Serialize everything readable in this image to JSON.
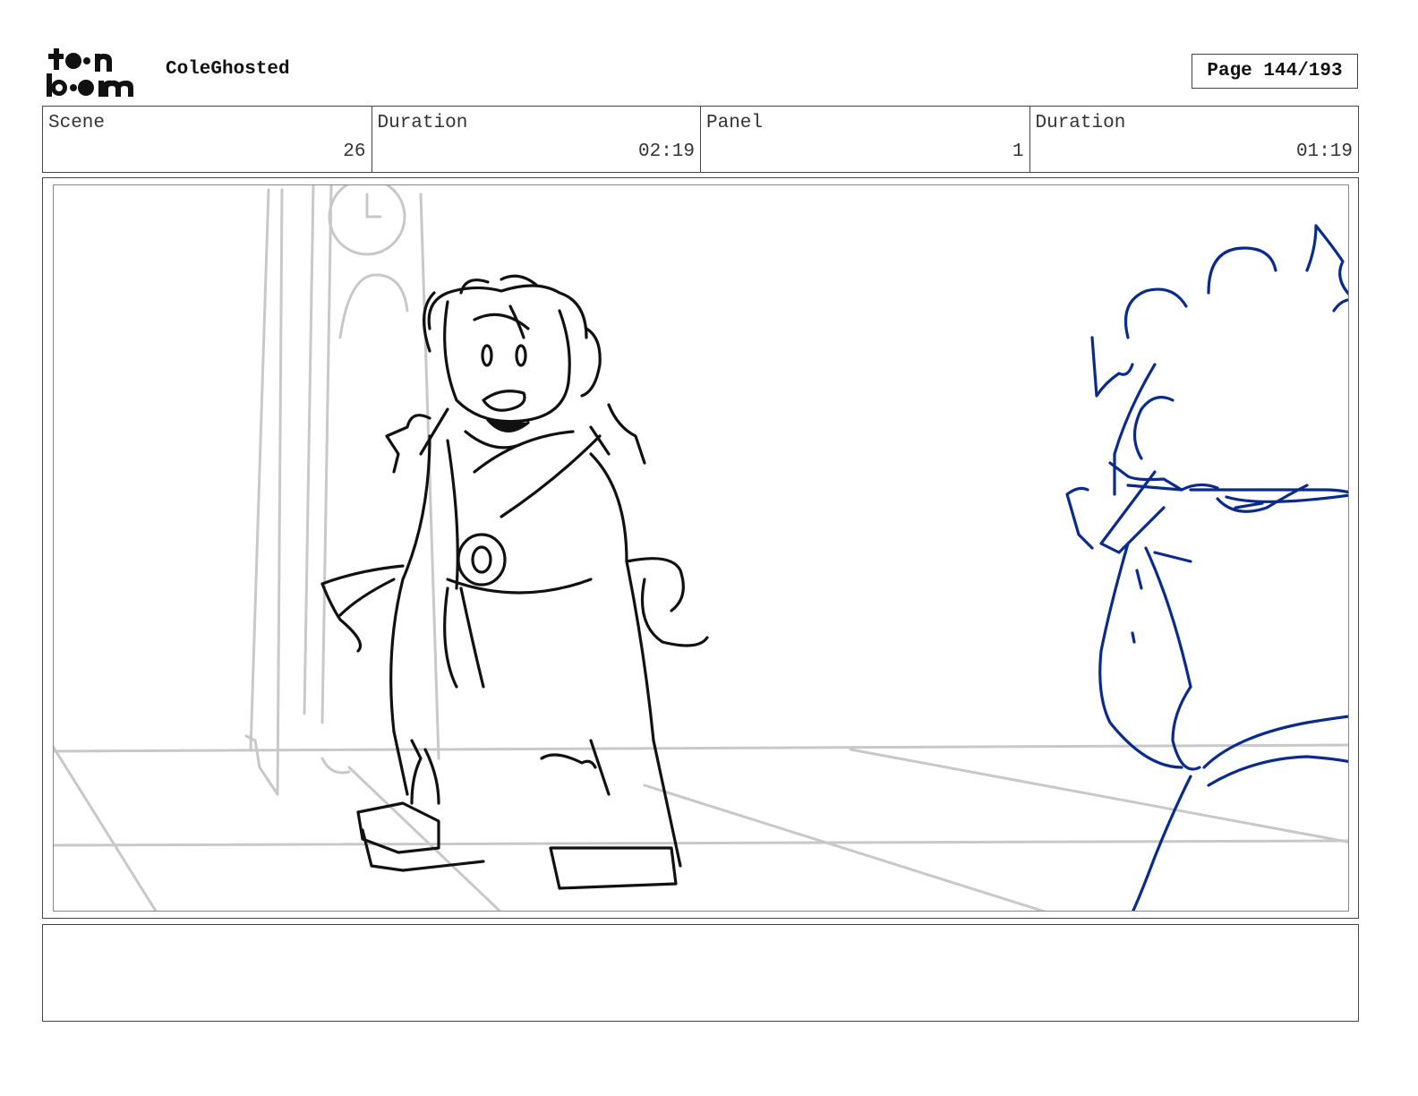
{
  "header": {
    "logo_text": "toon boom",
    "project_title": "ColeGhosted",
    "page_label": "Page 144/193"
  },
  "info": {
    "scene_label": "Scene",
    "scene_value": "26",
    "scene_duration_label": "Duration",
    "scene_duration_value": "02:19",
    "panel_label": "Panel",
    "panel_value": "1",
    "panel_duration_label": "Duration",
    "panel_duration_value": "01:19"
  },
  "notes": {
    "text": ""
  },
  "colors": {
    "ink": "#111111",
    "background_lines": "#c8c8c8",
    "character_blue": "#0a2a8c"
  }
}
